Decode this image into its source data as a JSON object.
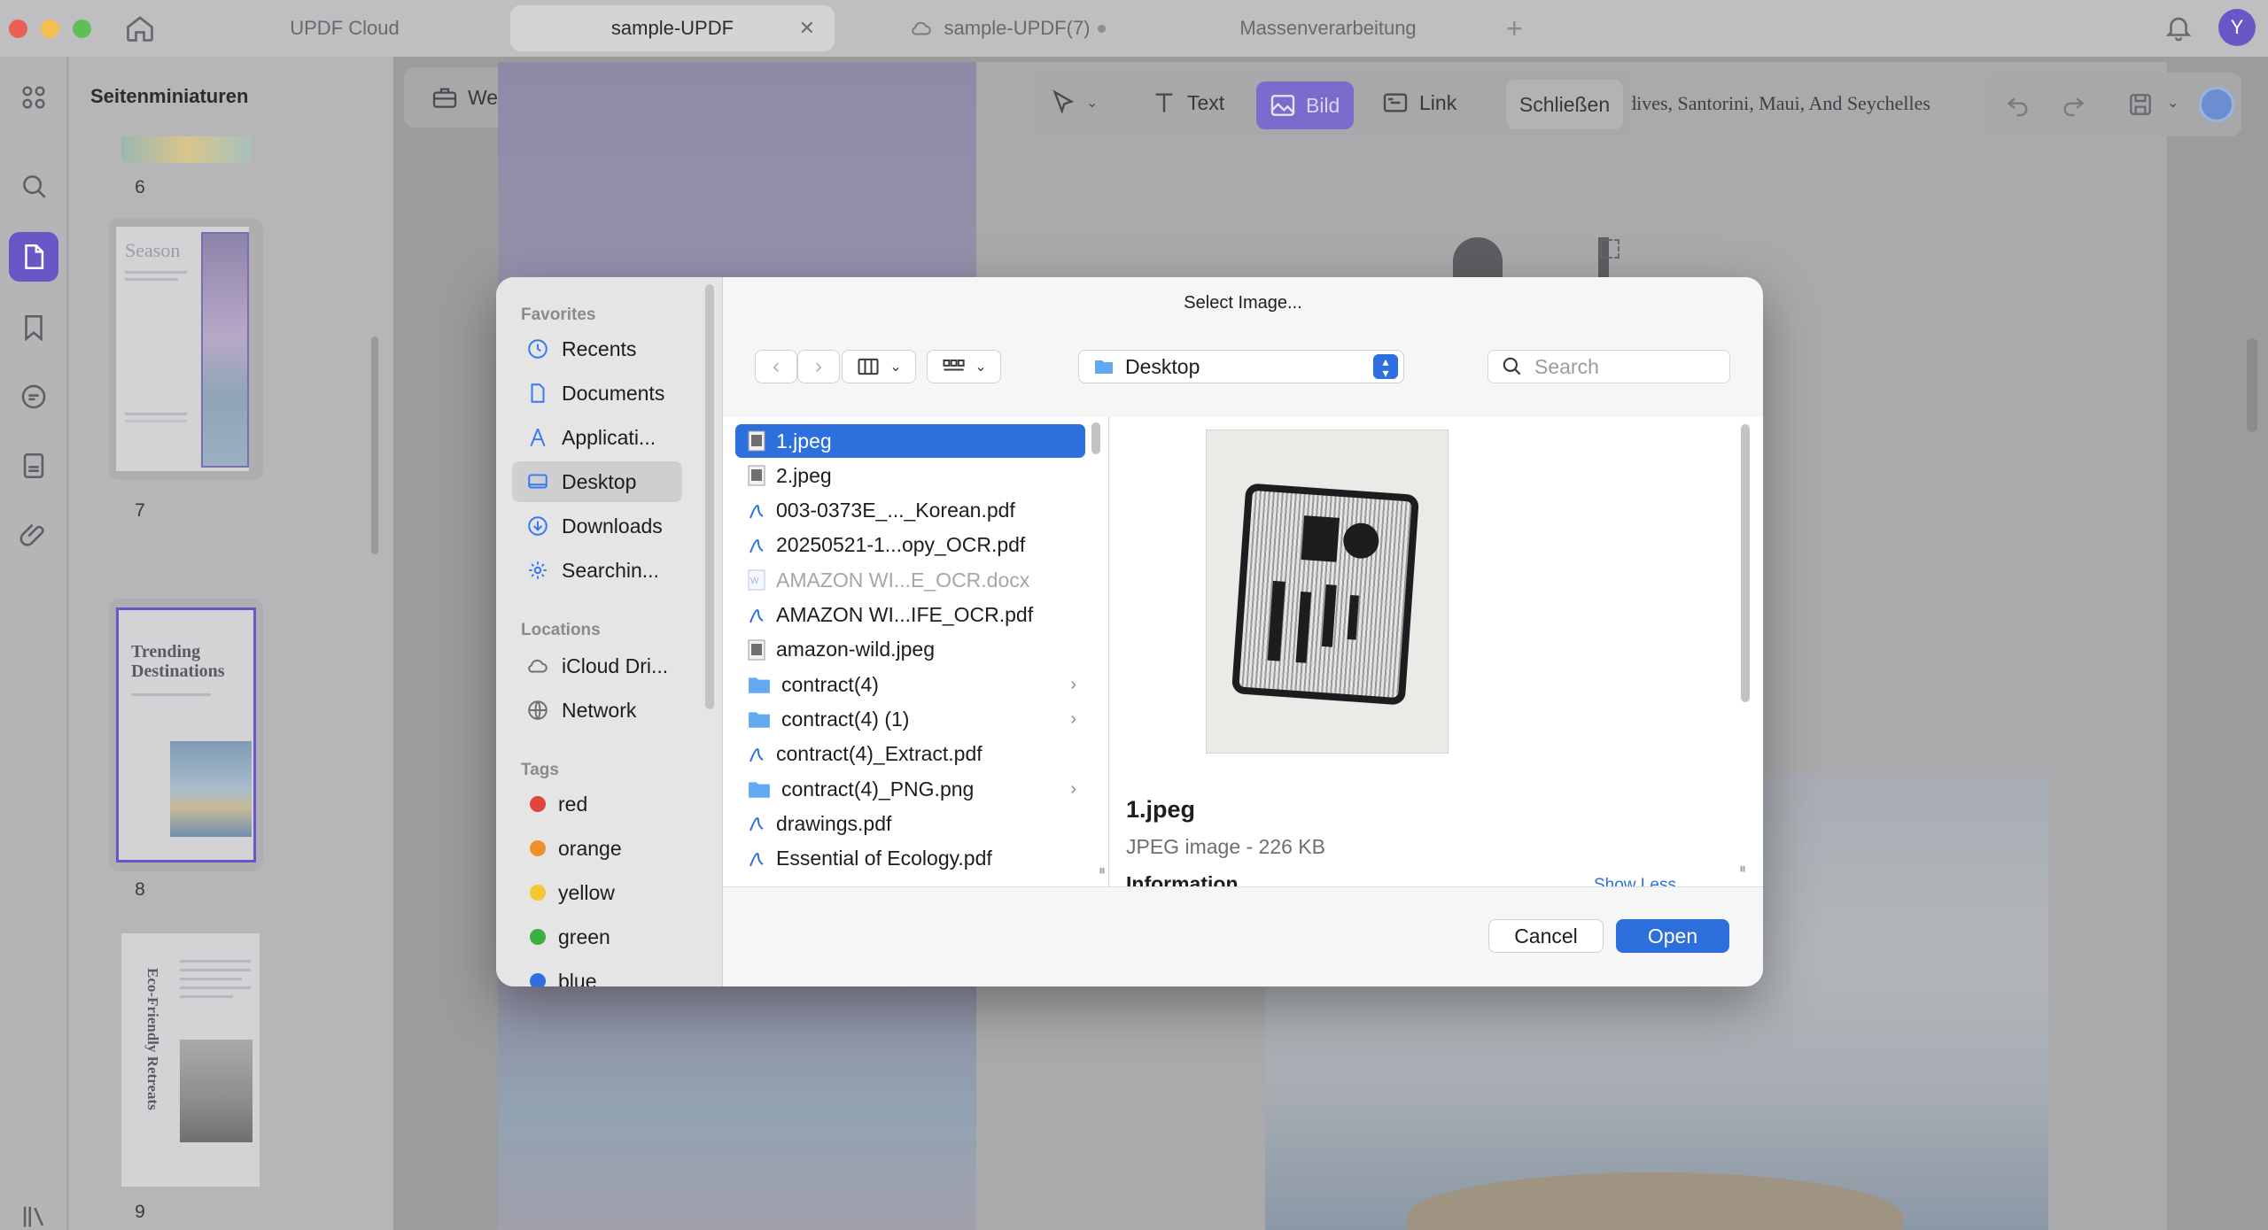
{
  "tabs": [
    {
      "label": "UPDF Cloud"
    },
    {
      "label": "sample-UPDF"
    },
    {
      "label": "sample-UPDF(7)"
    },
    {
      "label": "Massenverarbeitung"
    }
  ],
  "user_avatar_letter": "Y",
  "thumbnails": {
    "panel_title": "Seitenminiaturen",
    "pages": [
      {
        "number": "6"
      },
      {
        "number": "7",
        "heading": "Season"
      },
      {
        "number": "8",
        "heading": "Trending Destinations"
      },
      {
        "number": "9",
        "heading": "Eco-Friendly Retreats"
      }
    ]
  },
  "toolbar": {
    "tools_label": "Werkzeuge",
    "text_label": "Text",
    "image_label": "Bild",
    "link_label": "Link",
    "close_label": "Schließen"
  },
  "document": {
    "header_text": "ldives, Santorini, Maui, And Seychelles"
  },
  "dialog": {
    "title": "Select Image...",
    "location": "Desktop",
    "search_placeholder": "Search",
    "sidebar": {
      "favorites_heading": "Favorites",
      "favorites": [
        {
          "label": "Recents",
          "icon": "clock-icon"
        },
        {
          "label": "Documents",
          "icon": "document-icon"
        },
        {
          "label": "Applicati...",
          "icon": "applications-icon"
        },
        {
          "label": "Desktop",
          "icon": "desktop-icon"
        },
        {
          "label": "Downloads",
          "icon": "downloads-icon"
        },
        {
          "label": "Searchin...",
          "icon": "gear-icon"
        }
      ],
      "locations_heading": "Locations",
      "locations": [
        {
          "label": "iCloud Dri...",
          "icon": "cloud-icon"
        },
        {
          "label": "Network",
          "icon": "globe-icon"
        }
      ],
      "tags_heading": "Tags",
      "tags": [
        {
          "label": "red",
          "color": "#e0443e"
        },
        {
          "label": "orange",
          "color": "#f0922b"
        },
        {
          "label": "yellow",
          "color": "#f2c82f"
        },
        {
          "label": "green",
          "color": "#3cb043"
        },
        {
          "label": "blue",
          "color": "#2f6fe0"
        }
      ]
    },
    "files": [
      {
        "name": "1.jpeg",
        "type": "image"
      },
      {
        "name": "2.jpeg",
        "type": "image"
      },
      {
        "name": "003-0373E_..._Korean.pdf",
        "type": "pdf"
      },
      {
        "name": "20250521-1...opy_OCR.pdf",
        "type": "pdf"
      },
      {
        "name": "AMAZON WI...E_OCR.docx",
        "type": "docx"
      },
      {
        "name": "AMAZON WI...IFE_OCR.pdf",
        "type": "pdf"
      },
      {
        "name": "amazon-wild.jpeg",
        "type": "image"
      },
      {
        "name": "contract(4)",
        "type": "folder"
      },
      {
        "name": "contract(4) (1)",
        "type": "folder"
      },
      {
        "name": "contract(4)_Extract.pdf",
        "type": "pdf"
      },
      {
        "name": "contract(4)_PNG.png",
        "type": "folder"
      },
      {
        "name": "drawings.pdf",
        "type": "pdf"
      },
      {
        "name": "Essential of Ecology.pdf",
        "type": "pdf"
      }
    ],
    "preview": {
      "file_name": "1.jpeg",
      "file_info": "JPEG image - 226 KB",
      "info_heading": "Information",
      "show_less": "Show Less"
    },
    "cancel_label": "Cancel",
    "open_label": "Open"
  }
}
